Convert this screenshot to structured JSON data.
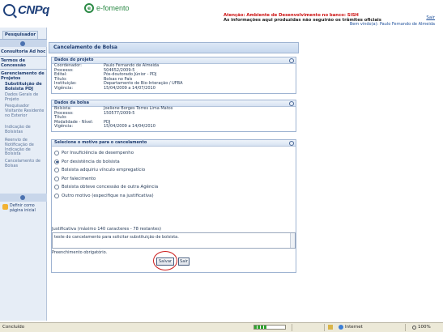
{
  "header": {
    "brand": "CNPq",
    "product": "e-fomento",
    "alert_line1": "Atenção: Ambiente de Desenvolvimento no banco: SISH",
    "alert_line2": "As informações aqui produzidas não seguirão os trâmites oficiais",
    "exit_link": "Sair",
    "welcome": "Bem vindo(a): Paulo Fernando de Almeida"
  },
  "sidebar": {
    "tab": "Pesquisador",
    "items": [
      {
        "label": "Consultoria Ad hoc",
        "type": "head"
      },
      {
        "label": "Termos de Concessão",
        "type": "head"
      },
      {
        "label": "Gerenciamento de Projetos",
        "type": "head"
      },
      {
        "label": "Substituição de Bolsista PDJ",
        "type": "active"
      },
      {
        "label": "Dados Gerais de Projeto",
        "type": "sub"
      },
      {
        "label": "Pesquisador Visitante Residente no Exterior",
        "type": "sub"
      },
      {
        "label": "Indicação de Bolsistas",
        "type": "sub"
      },
      {
        "label": "Reenvio de Notificação de Indicação de Bolsista",
        "type": "sub"
      },
      {
        "label": "Cancelamento de Bolsas",
        "type": "sub"
      }
    ],
    "home_link": "Definir como página inicial"
  },
  "main": {
    "title": "Cancelamento de Bolsa",
    "project": {
      "title": "Dados do projeto",
      "rows": [
        {
          "k": "Coordenador:",
          "v": "Paulo Fernando de Almeida"
        },
        {
          "k": "Processo:",
          "v": "504652/2009-5"
        },
        {
          "k": "Edital:",
          "v": "Pós-doutorado Júnior - PDJ"
        },
        {
          "k": "Título:",
          "v": "Bolsas no País"
        },
        {
          "k": "Instituição:",
          "v": "Departamento de Bio-Interação / UFBA"
        },
        {
          "k": "Vigência:",
          "v": "15/04/2009 a 14/07/2010"
        }
      ]
    },
    "bolsa": {
      "title": "Dados da bolsa",
      "rows": [
        {
          "k": "Bolsista:",
          "v": "Joeliene Borges Torres Lima Matos"
        },
        {
          "k": "Processo:",
          "v": "150577/2009-5"
        },
        {
          "k": "Título:",
          "v": ""
        },
        {
          "k": "Modalidade - Nível:",
          "v": "PDJ"
        },
        {
          "k": "Vigência:",
          "v": "15/04/2009 a 14/04/2010"
        }
      ]
    },
    "reasons": {
      "title": "Selecione o motivo para o cancelamento",
      "options": [
        {
          "label": "Por Insuficiência de desempenho",
          "selected": false
        },
        {
          "label": "Por desistência do bolsista",
          "selected": true
        },
        {
          "label": "Bolsista adquiriu vínculo empregatício",
          "selected": false
        },
        {
          "label": "Por falecimento",
          "selected": false
        },
        {
          "label": "Bolsista obteve concessão de outra Agência",
          "selected": false
        },
        {
          "label": "Outro motivo (especifique na justificativa)",
          "selected": false
        }
      ]
    },
    "justification": {
      "label": "Justificativa (máximo 140 caracteres - 78 restantes)",
      "value": "teste do cancelamento para solicitar substituição de bolsista.",
      "required_note": "Preenchimento obrigatório."
    },
    "buttons": {
      "save": "Salvar",
      "exit": "Sair"
    }
  },
  "statusbar": {
    "text": "Concluído",
    "zone": "Internet",
    "zoom": "100%"
  },
  "colors": {
    "alert": "#cc1111",
    "brand": "#1d3f7a",
    "efomento": "#2c8a46",
    "highlight": "#cc1d1d"
  }
}
